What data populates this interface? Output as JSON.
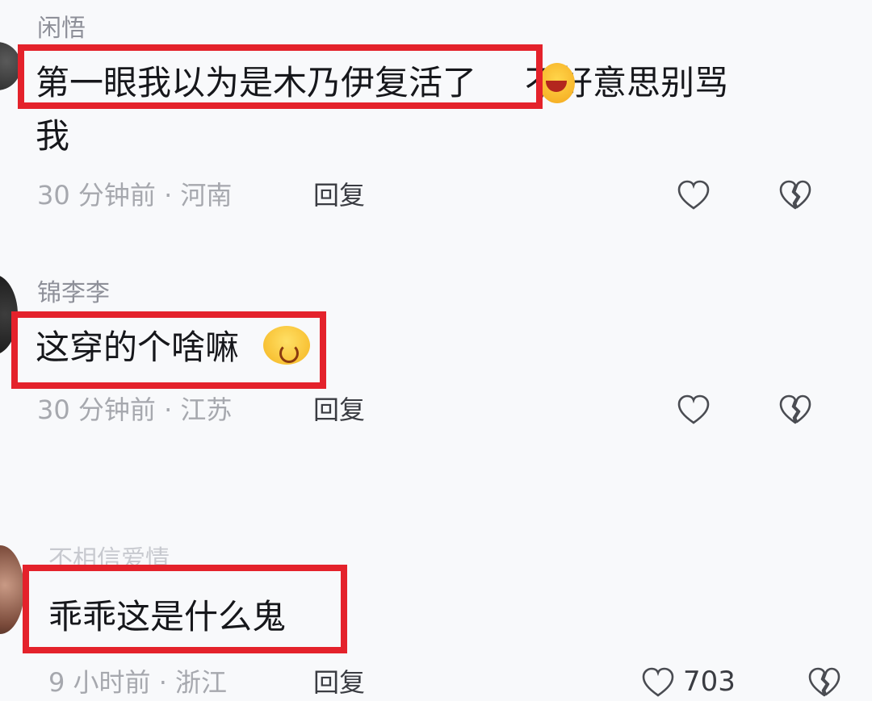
{
  "comments": [
    {
      "username": "闲悟",
      "text_line1_highlighted": "第一眼我以为是木乃伊复活了",
      "emoji": "laughing-emoji",
      "text_line1_rest": "不好意思别骂",
      "text_line2": "我",
      "time": "30 分钟前 · 河南",
      "reply_label": "回复"
    },
    {
      "username": "锦李李",
      "text": "这穿的个啥嘛",
      "emoji": "shy-emoji",
      "time": "30 分钟前 · 江苏",
      "reply_label": "回复"
    },
    {
      "username": "不相信爱情",
      "text": "乖乖这是什么鬼",
      "time": "9 小时前 · 浙江",
      "reply_label": "回复",
      "like_count": "703"
    }
  ],
  "icons": {
    "like": "heart-outline-icon",
    "dislike": "broken-heart-icon"
  },
  "colors": {
    "highlight_box": "#e4222b",
    "background": "#f8f9fb",
    "comment_text": "#16171b",
    "meta_text": "#a6a8ae"
  }
}
